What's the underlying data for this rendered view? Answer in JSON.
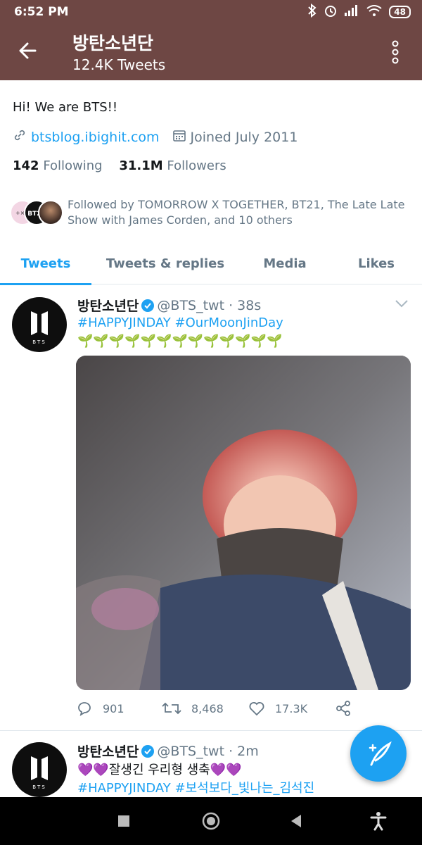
{
  "status_bar": {
    "time": "6:52 PM",
    "battery": "48"
  },
  "header": {
    "title": "방탄소년단",
    "subtitle": "12.4K Tweets"
  },
  "profile": {
    "handle": "@BTS_twt",
    "bio": "Hi! We are BTS!!",
    "website": "btsblog.ibighit.com",
    "joined": "Joined July 2011",
    "following_count": "142",
    "following_label": "Following",
    "followers_count": "31.1M",
    "followers_label": "Followers",
    "followed_by": "Followed by TOMORROW X TOGETHER, BT21, The Late Late Show with James Corden, and 10 others"
  },
  "tabs": [
    {
      "label": "Tweets",
      "active": true
    },
    {
      "label": "Tweets & replies",
      "active": false
    },
    {
      "label": "Media",
      "active": false
    },
    {
      "label": "Likes",
      "active": false
    }
  ],
  "tweets": [
    {
      "name": "방탄소년단",
      "meta": "@BTS_twt · 38s",
      "hashtags": "#HAPPYJINDAY #OurMoonJinDay",
      "sprouts": "🌱🌱🌱🌱🌱🌱🌱🌱🌱🌱🌱🌱🌱",
      "replies": "901",
      "retweets": "8,468",
      "likes": "17.3K"
    },
    {
      "name": "방탄소년단",
      "meta": "@BTS_twt · 2m",
      "text": "💜💜잘생긴 우리형 생축💜💜",
      "hashtags": "#HAPPYJINDAY #보석보다_빛나는_김석진"
    }
  ],
  "colors": {
    "brand": "#1da1f2",
    "header_bg": "#6e4744"
  }
}
